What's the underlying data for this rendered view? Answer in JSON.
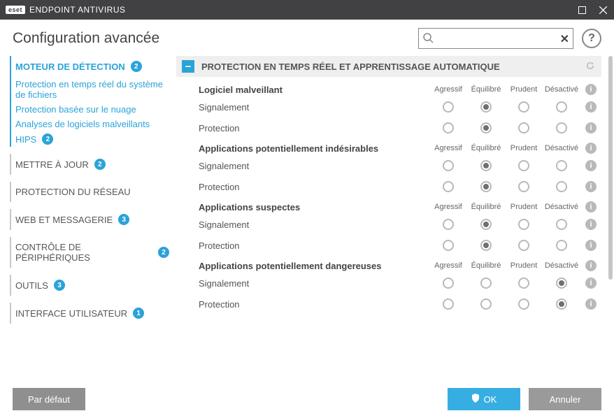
{
  "titlebar": {
    "brand": "eset",
    "product": "ENDPOINT ANTIVIRUS"
  },
  "page_title": "Configuration avancée",
  "search": {
    "value": "",
    "placeholder": ""
  },
  "sidebar": {
    "items": [
      {
        "label": "Moteur de détection",
        "badge": "2",
        "active": true
      },
      {
        "label": "Mettre à jour",
        "badge": "2"
      },
      {
        "label": "Protection du réseau",
        "badge": ""
      },
      {
        "label": "Web et messagerie",
        "badge": "3"
      },
      {
        "label": "Contrôle de périphériques",
        "badge": "2"
      },
      {
        "label": "Outils",
        "badge": "3"
      },
      {
        "label": "Interface utilisateur",
        "badge": "1"
      }
    ],
    "subitems": [
      {
        "label": "Protection en temps réel du système de fichiers"
      },
      {
        "label": "Protection basée sur le nuage"
      },
      {
        "label": "Analyses de logiciels malveillants"
      },
      {
        "label": "HIPS",
        "badge": "2"
      }
    ]
  },
  "section": {
    "title": "PROTECTION EN TEMPS RÉEL ET APPRENTISSAGE AUTOMATIQUE",
    "columns": [
      "Agressif",
      "Équilibré",
      "Prudent",
      "Désactivé"
    ]
  },
  "groups": [
    {
      "title": "Logiciel malveillant",
      "rows": [
        {
          "label": "Signalement",
          "selected": 1
        },
        {
          "label": "Protection",
          "selected": 1
        }
      ]
    },
    {
      "title": "Applications potentiellement indésirables",
      "rows": [
        {
          "label": "Signalement",
          "selected": 1
        },
        {
          "label": "Protection",
          "selected": 1
        }
      ]
    },
    {
      "title": "Applications suspectes",
      "rows": [
        {
          "label": "Signalement",
          "selected": 1
        },
        {
          "label": "Protection",
          "selected": 1
        }
      ]
    },
    {
      "title": "Applications potentiellement dangereuses",
      "rows": [
        {
          "label": "Signalement",
          "selected": 3
        },
        {
          "label": "Protection",
          "selected": 3
        }
      ]
    }
  ],
  "footer": {
    "default": "Par défaut",
    "ok": "OK",
    "cancel": "Annuler"
  }
}
